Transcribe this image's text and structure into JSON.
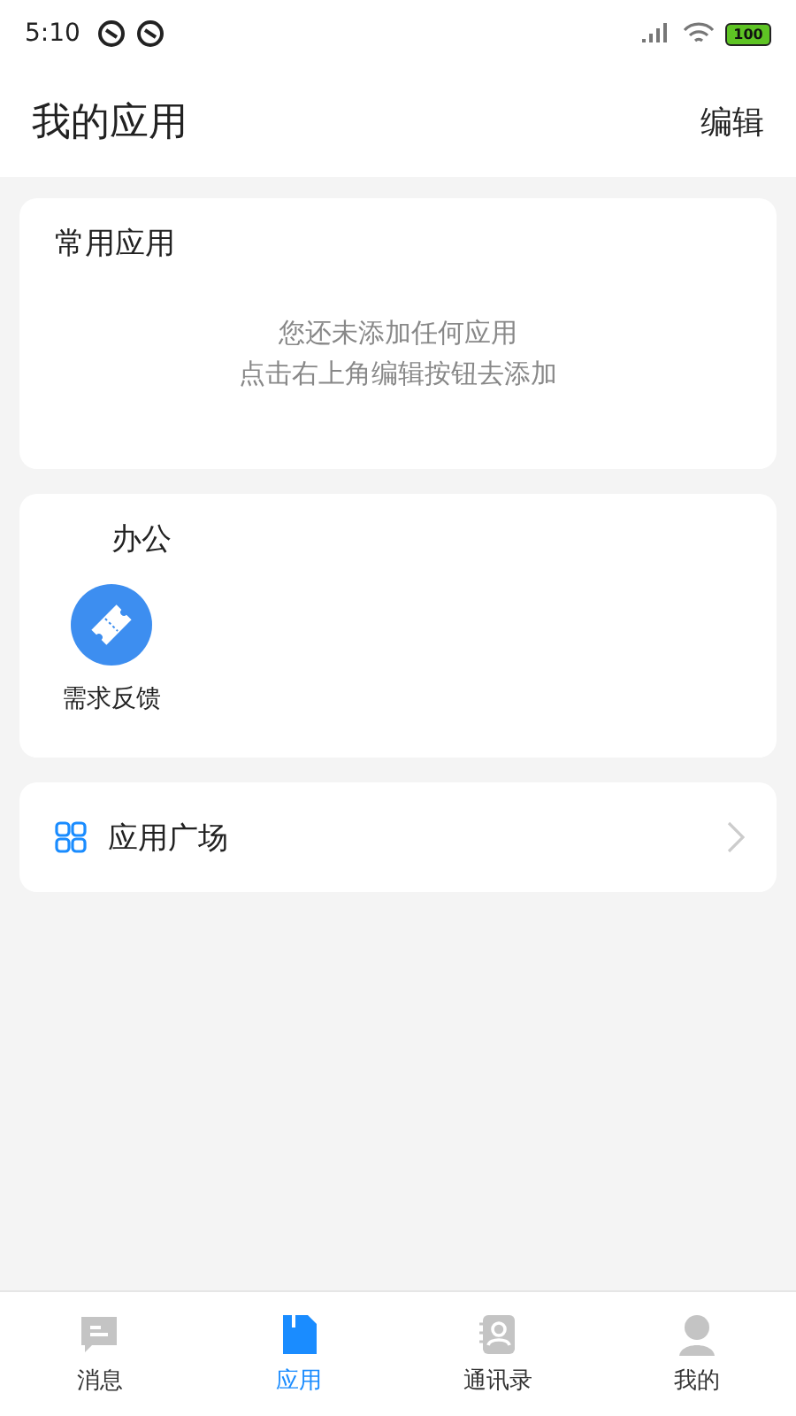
{
  "status_bar": {
    "time": "5:10",
    "battery": "100"
  },
  "header": {
    "title": "我的应用",
    "action": "编辑"
  },
  "common_apps": {
    "title": "常用应用",
    "empty_lines": [
      "您还未添加任何应用",
      "点击右上角编辑按钮去添加"
    ]
  },
  "office": {
    "title": "办公",
    "apps": [
      {
        "label": "需求反馈"
      }
    ]
  },
  "app_plaza": {
    "label": "应用广场"
  },
  "tabs": [
    {
      "kind": "message",
      "label": "消息",
      "selected": false
    },
    {
      "kind": "apps",
      "label": "应用",
      "selected": true
    },
    {
      "kind": "contacts",
      "label": "通讯录",
      "selected": false
    },
    {
      "kind": "me",
      "label": "我的",
      "selected": false
    }
  ]
}
